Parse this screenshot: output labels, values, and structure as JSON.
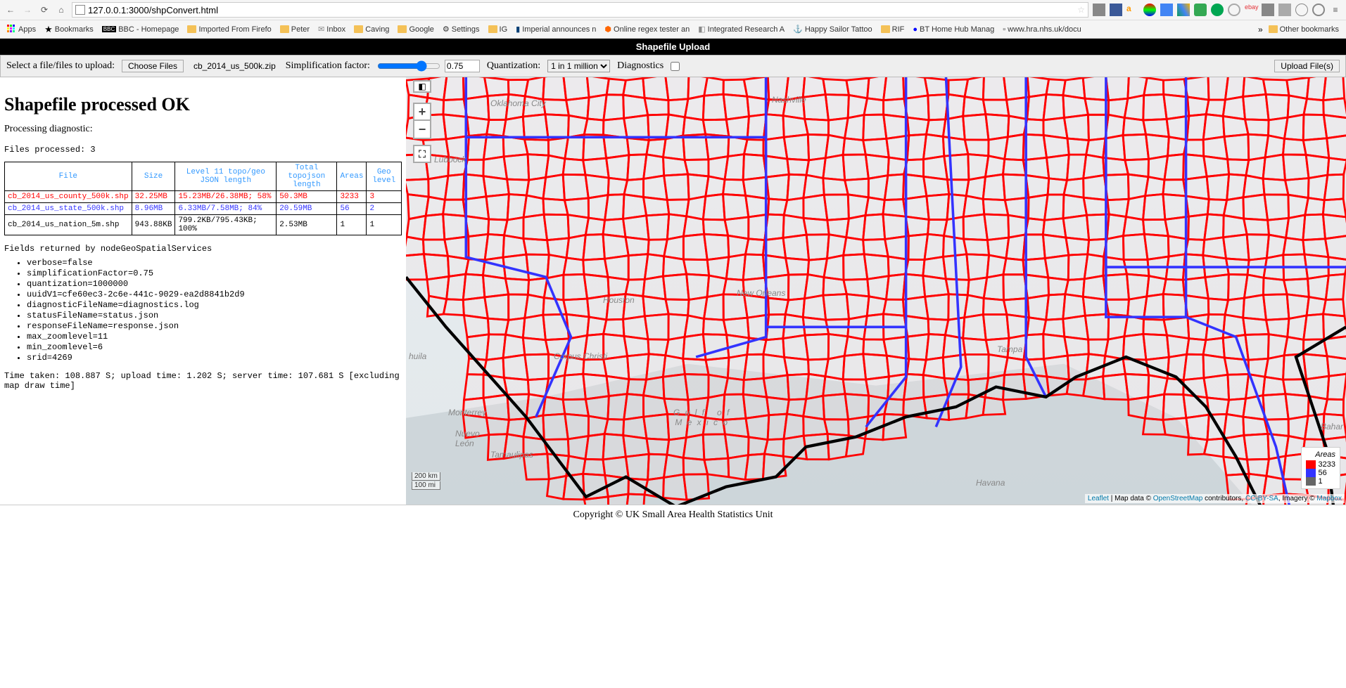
{
  "browser": {
    "url": "127.0.0.1:3000/shpConvert.html",
    "bookmarks": [
      {
        "label": "Apps",
        "type": "apps"
      },
      {
        "label": "Bookmarks",
        "type": "star"
      },
      {
        "label": "BBC - Homepage",
        "type": "bbc"
      },
      {
        "label": "Imported From Firefo",
        "type": "folder"
      },
      {
        "label": "Peter",
        "type": "folder"
      },
      {
        "label": "Inbox",
        "type": "mail"
      },
      {
        "label": "Caving",
        "type": "folder"
      },
      {
        "label": "Google",
        "type": "folder"
      },
      {
        "label": "Settings",
        "type": "gear"
      },
      {
        "label": "IG",
        "type": "folder"
      },
      {
        "label": "Imperial announces n",
        "type": "page"
      },
      {
        "label": "Online regex tester an",
        "type": "page"
      },
      {
        "label": "Integrated Research A",
        "type": "page"
      },
      {
        "label": "Happy Sailor Tattoo",
        "type": "page"
      },
      {
        "label": "RIF",
        "type": "folder"
      },
      {
        "label": "BT Home Hub Manag",
        "type": "page"
      },
      {
        "label": "www.hra.nhs.uk/docu",
        "type": "page"
      }
    ],
    "other_bookmarks": "Other bookmarks"
  },
  "header": {
    "title": "Shapefile Upload"
  },
  "controls": {
    "select_label": "Select a file/files to upload:",
    "choose_btn": "Choose Files",
    "chosen_file": "cb_2014_us_500k.zip",
    "simplification_label": "Simplification factor:",
    "simplification_value": "0.75",
    "quantization_label": "Quantization:",
    "quantization_options": [
      "1 in 1 million"
    ],
    "quantization_selected": "1 in 1 million",
    "diagnostics_label": "Diagnostics",
    "upload_btn": "Upload File(s)"
  },
  "result": {
    "heading": "Shapefile processed OK",
    "subheading": "Processing diagnostic:",
    "files_processed": "Files processed: 3",
    "table": {
      "headers": [
        "File",
        "Size",
        "Level 11 topo/geo JSON length",
        "Total topojson length",
        "Areas",
        "Geo level"
      ],
      "rows": [
        {
          "cls": "red",
          "cells": [
            "cb_2014_us_county_500k.shp",
            "32.25MB",
            "15.23MB/26.38MB; 58%",
            "50.3MB",
            "3233",
            "3"
          ]
        },
        {
          "cls": "blue",
          "cells": [
            "cb_2014_us_state_500k.shp",
            "8.96MB",
            "6.33MB/7.58MB; 84%",
            "20.59MB",
            "56",
            "2"
          ]
        },
        {
          "cls": "",
          "cells": [
            "cb_2014_us_nation_5m.shp",
            "943.88KB",
            "799.2KB/795.43KB; 100%",
            "2.53MB",
            "1",
            "1"
          ]
        }
      ]
    },
    "fields_label": "Fields returned by nodeGeoSpatialServices",
    "fields": [
      "verbose=false",
      "simplificationFactor=0.75",
      "quantization=1000000",
      "uuidV1=cfe60ec3-2c6e-441c-9029-ea2d8841b2d9",
      "diagnosticFileName=diagnostics.log",
      "statusFileName=status.json",
      "responseFileName=response.json",
      "max_zoomlevel=11",
      "min_zoomlevel=6",
      "srid=4269"
    ],
    "timing": "Time taken: 108.887 S; upload time: 1.202 S; server time: 107.681 S [excluding map draw time]"
  },
  "map": {
    "labels": {
      "monterrey": "Monterrey",
      "nuevo_leon": "Nuevo\nLeón",
      "tamaulipas": "Tamaulipas",
      "coahuila": "huila",
      "lubbock": "Lubbock",
      "okc": "Oklahoma City",
      "corpus": "Corpus Christi",
      "houston": "Houston",
      "neworleans": "New Orleans",
      "nashville": "Nashville",
      "tampa": "Tampa",
      "havana": "Havana",
      "bahamas": "Bahar",
      "gulf": "G u l f   o f\nM e x i c o"
    },
    "zoom_plus": "+",
    "zoom_minus": "−",
    "fullscreen": "⛶",
    "layers_icon": "◧",
    "scale_km": "200 km",
    "scale_mi": "100 mi",
    "attrib": {
      "leaflet": "Leaflet",
      "mid1": " | Map data © ",
      "osm": "OpenStreetMap",
      "mid2": " contributors, ",
      "cc": "CC-BY-SA",
      "mid3": ", Imagery © ",
      "mapbox": "Mapbox"
    },
    "legend": {
      "title": "Areas",
      "items": [
        {
          "color": "#ff0000",
          "label": "3233"
        },
        {
          "color": "#3333ff",
          "label": "56"
        },
        {
          "color": "#666666",
          "label": "1"
        }
      ]
    }
  },
  "footer": {
    "text": "Copyright © UK Small Area Health Statistics Unit"
  }
}
